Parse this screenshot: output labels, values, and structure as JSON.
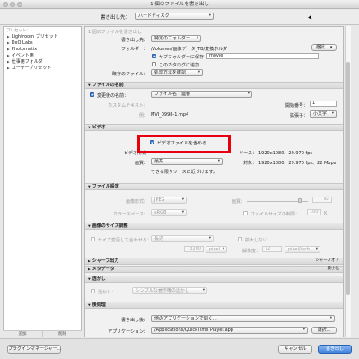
{
  "window": {
    "title": "1 個のファイルを書き出し"
  },
  "toolbar": {
    "export_to_label": "書き出し先：",
    "export_to_value": "ハードディスク"
  },
  "sidebar": {
    "header": "プリセット：",
    "items": [
      {
        "label": "Lightroom プリセット"
      },
      {
        "label": "DxO Labs"
      },
      {
        "label": "Photomatix"
      },
      {
        "label": "イベント用"
      },
      {
        "label": "仕事用フォルダ"
      },
      {
        "label": "ユーザープリセット"
      }
    ],
    "add_button": "追加",
    "remove_button": "削除"
  },
  "main": {
    "header": "1 個のファイルを書き出し",
    "export_location": {
      "export_to_label": "書き出し先：",
      "export_to_value": "特定のフォルダー",
      "folder_label": "フォルダー：",
      "folder_path": "/Volumes/画像データ_TB/変換ホルダー",
      "choose_button": "選択...",
      "subfolder_label": "サブフォルダーに保存",
      "subfolder_checked": true,
      "subfolder_name": "movie",
      "add_catalog_label": "このカタログに追加",
      "add_catalog_checked": false,
      "existing_label": "既存のファイル：",
      "existing_value": "処理方法を確認"
    },
    "file_naming": {
      "section_title": "ファイルの名前",
      "rename_label": "変更後の名前：",
      "rename_checked": true,
      "rename_value": "ファイル名 - 連番",
      "custom_text_label": "カスタムテキスト：",
      "start_number_label": "開始番号：",
      "start_number_value": "1",
      "sample": "MVI_0998-1.mp4",
      "extension_label": "拡張子：",
      "extension_value": "小文字"
    },
    "video": {
      "section_title": "ビデオ",
      "include_label": "ビデオファイルを含める",
      "include_checked": true,
      "format_label": "ビデオ形式",
      "source_label": "ソース：",
      "source_value": "1920x1080、29.970 fps",
      "quality_label": "画質：",
      "quality_value": "最高",
      "target_label": "対象：",
      "target_value": "1920x1080、29.970 fps、22 Mbps",
      "quality_note": "できる限りソースに近づけます。"
    },
    "file_settings": {
      "section_title": "ファイル設定",
      "format_label": "画像形式：",
      "format_value": "JPEG",
      "quality_label": "画質：",
      "quality_value": "92",
      "colorspace_label": "カラースペース：",
      "colorspace_value": "sRGB",
      "limit_label": "ファイルサイズの制限：",
      "limit_value": "100",
      "limit_unit": "K"
    },
    "image_sizing": {
      "section_title": "画像のサイズ調整",
      "resize_label": "サイズ変更して合わせる：",
      "resize_value": "長辺",
      "dont_enlarge_label": "拡大しない",
      "width_value": "3200",
      "width_unit": "pixel",
      "resolution_label": "解像度：",
      "resolution_value": "72",
      "resolution_unit": "pixel/inch"
    },
    "output_sharpening": {
      "section_title": "シャープ出力",
      "status": "シャープオフ"
    },
    "metadata": {
      "section_title": "メタデータ",
      "status": "最小化"
    },
    "watermark": {
      "section_title": "透かし",
      "watermark_label": "透かし：",
      "watermark_value": "シンプルな著作権の透かし"
    },
    "post_processing": {
      "section_title": "後処理",
      "after_export_label": "書き出し後：",
      "after_export_value": "他のアプリケーションで開く...",
      "application_label": "アプリケーション：",
      "application_value": "/Applications/QuickTime Player.app",
      "choose_button": "選択..."
    }
  },
  "footer": {
    "plugin_manager": "プラグインマネージャー...",
    "cancel": "キャンセル",
    "export": "書き出し"
  },
  "colors": {
    "highlight": "#e60012",
    "accent": "#3f82df"
  }
}
